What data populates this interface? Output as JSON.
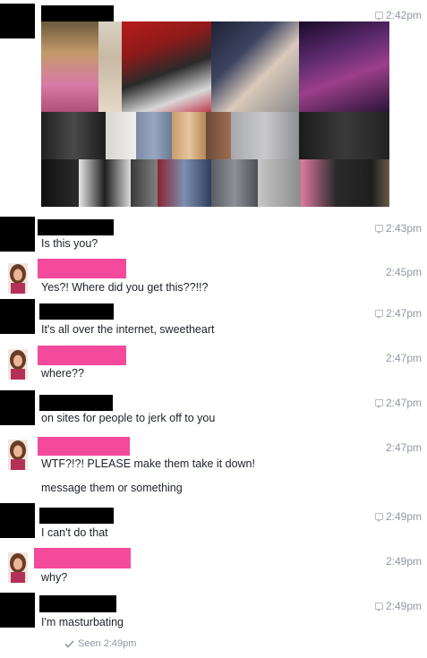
{
  "thread": {
    "seen_label": "Seen 2:49pm",
    "messages": [
      {
        "sender": "other",
        "time": "2:42pm",
        "lines": []
      },
      {
        "sender": "other",
        "time": "2:43pm",
        "lines": [
          "Is this you?"
        ]
      },
      {
        "sender": "self",
        "time": "2:45pm",
        "lines": [
          "Yes?! Where did you get this??!!?"
        ]
      },
      {
        "sender": "other",
        "time": "2:47pm",
        "lines": [
          "It's all over the internet, sweetheart"
        ]
      },
      {
        "sender": "self",
        "time": "2:47pm",
        "lines": [
          "where??"
        ]
      },
      {
        "sender": "other",
        "time": "2:47pm",
        "lines": [
          "on sites for people to jerk off to you"
        ]
      },
      {
        "sender": "self",
        "time": "2:47pm",
        "lines": [
          "WTF?!?! PLEASE make them take it down!",
          "message them or something"
        ]
      },
      {
        "sender": "other",
        "time": "2:49pm",
        "lines": [
          "I can't do that"
        ]
      },
      {
        "sender": "self",
        "time": "2:49pm",
        "lines": [
          "why?"
        ]
      },
      {
        "sender": "other",
        "time": "2:49pm",
        "lines": [
          "I'm masturbating"
        ]
      }
    ]
  },
  "colors": {
    "redaction_black": "#000000",
    "redaction_pink": "#f44a9c",
    "timestamp": "#9197a3",
    "message_text": "#1d2129"
  },
  "icons": {
    "timestamp": "chat-bubble-icon",
    "seen": "checkmark-icon"
  }
}
